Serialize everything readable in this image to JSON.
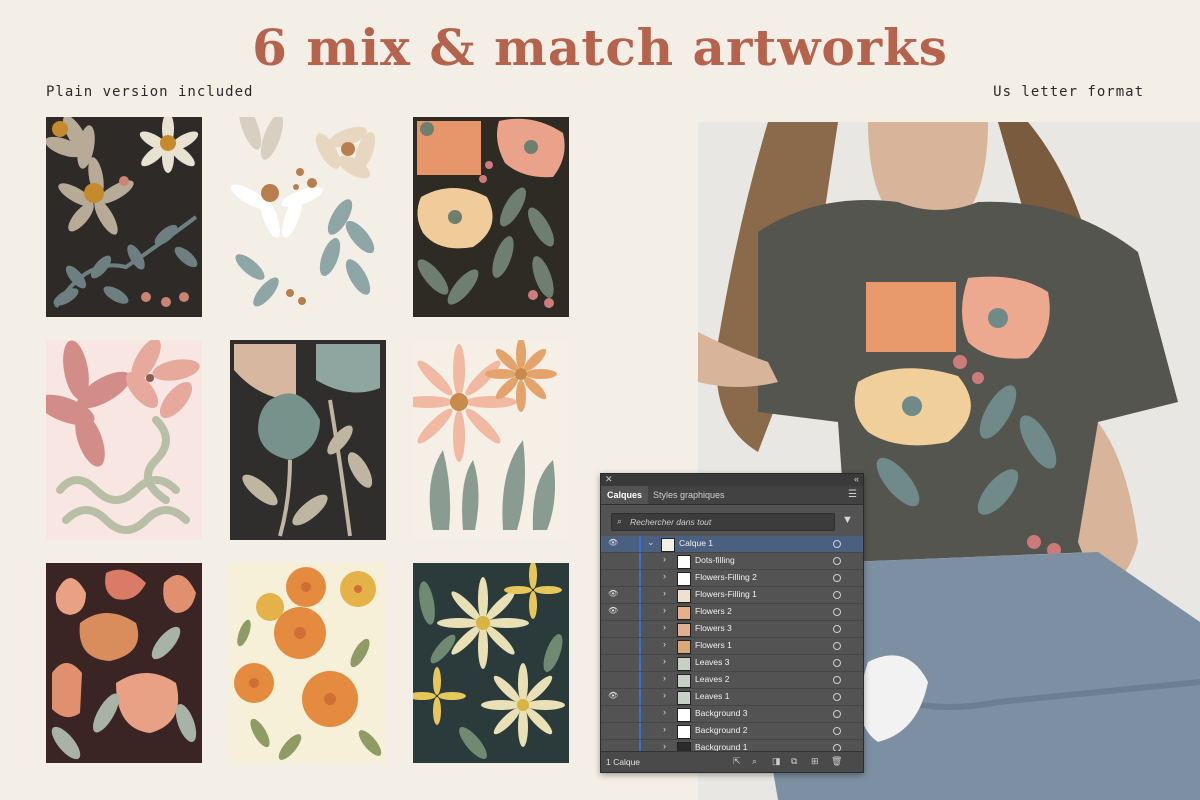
{
  "header": {
    "title": "6 mix & match artworks",
    "left_note": "Plain version included",
    "right_note": "Us letter format"
  },
  "layers_panel": {
    "tabs": [
      "Calques",
      "Styles graphiques"
    ],
    "search_placeholder": "Rechercher dans tout",
    "layers": [
      {
        "name": "Calque 1",
        "visible": true,
        "level": 0,
        "expanded": true,
        "selected": true
      },
      {
        "name": "Dots-filling",
        "visible": false,
        "level": 1
      },
      {
        "name": "Flowers-Filling 2",
        "visible": false,
        "level": 1
      },
      {
        "name": "Flowers-Filling 1",
        "visible": true,
        "level": 1
      },
      {
        "name": "Flowers 2",
        "visible": true,
        "level": 1
      },
      {
        "name": "Flowers 3",
        "visible": false,
        "level": 1
      },
      {
        "name": "Flowers 1",
        "visible": false,
        "level": 1
      },
      {
        "name": "Leaves 3",
        "visible": false,
        "level": 1
      },
      {
        "name": "Leaves 2",
        "visible": false,
        "level": 1
      },
      {
        "name": "Leaves 1",
        "visible": true,
        "level": 1
      },
      {
        "name": "Background 3",
        "visible": false,
        "level": 1
      },
      {
        "name": "Background 2",
        "visible": false,
        "level": 1
      },
      {
        "name": "Background 1",
        "visible": false,
        "level": 1
      }
    ],
    "footer_count": "1 Calque"
  },
  "artworks": [
    {
      "name": "daisy-dark",
      "background": "#2e2a27",
      "colors": [
        "#b7aa97",
        "#e9e2d3",
        "#c48a2c",
        "#6e7f82",
        "#c98572"
      ]
    },
    {
      "name": "daisy-light",
      "background": "#f3efe7",
      "colors": [
        "#d8cfc2",
        "#e7d7c1",
        "#b97e4e",
        "#8ea6a6"
      ]
    },
    {
      "name": "poppy-dark",
      "background": "#2e2b24",
      "colors": [
        "#e7966c",
        "#eaa28a",
        "#f0cc9a",
        "#6f7f6f",
        "#cf7c7c"
      ]
    },
    {
      "name": "wave-pink",
      "background": "#f7e6e2",
      "colors": [
        "#d38d88",
        "#e6a99c",
        "#b9bfa6"
      ]
    },
    {
      "name": "tulip-dark",
      "background": "#2f2e2c",
      "colors": [
        "#d7b7a0",
        "#8fa59f",
        "#77928b",
        "#bfb6a2"
      ]
    },
    {
      "name": "daisy-peach",
      "background": "#f6efe6",
      "colors": [
        "#f1b9a1",
        "#e5a36c",
        "#8a9b92",
        "#c78b4b"
      ]
    },
    {
      "name": "tulip-maroon",
      "background": "#3b2524",
      "colors": [
        "#e1906f",
        "#e9a185",
        "#d97b66",
        "#a8b2a5",
        "#d98d5c"
      ]
    },
    {
      "name": "poppy-cream",
      "background": "#f6f0d8",
      "colors": [
        "#e58b3f",
        "#d06e38",
        "#e5b24a",
        "#8e9b64"
      ]
    },
    {
      "name": "daisy-teal",
      "background": "#2b3a3a",
      "colors": [
        "#e9e0b5",
        "#d8b33f",
        "#6f8a70",
        "#e7c65a"
      ]
    }
  ],
  "shirt": {
    "shirt_color": "#555550",
    "print_colors": [
      "#e89a6d",
      "#eda98f",
      "#f1cf9b",
      "#6f8a88",
      "#cc7b7b"
    ],
    "denim_color": "#7d90a3"
  }
}
